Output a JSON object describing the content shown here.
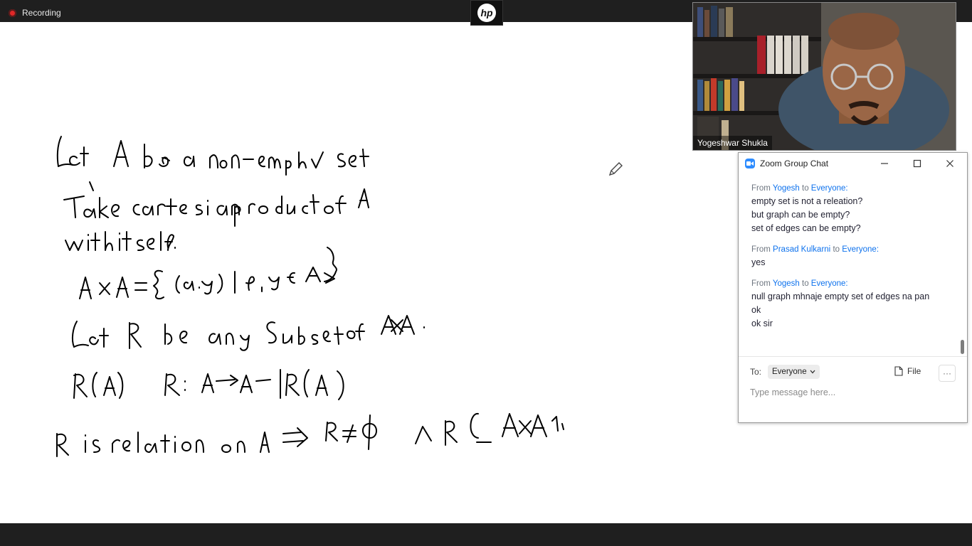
{
  "recording": {
    "label": "Recording"
  },
  "video": {
    "participant_name": "Yogeshwar Shukla"
  },
  "chat": {
    "title": "Zoom Group Chat",
    "groups": [
      {
        "from_label": "From",
        "sender": "Yogesh",
        "to_label": "to",
        "recipient": "Everyone:",
        "lines": [
          "empty set is not a releation?",
          "but graph can be empty?",
          "set of edges can be empty?"
        ]
      },
      {
        "from_label": "From",
        "sender": "Prasad Kulkarni",
        "to_label": "to",
        "recipient": "Everyone:",
        "lines": [
          "yes"
        ]
      },
      {
        "from_label": "From",
        "sender": "Yogesh",
        "to_label": "to",
        "recipient": "Everyone:",
        "lines": [
          "null graph mhnaje empty set of edges na pan",
          "ok",
          "ok sir"
        ]
      }
    ],
    "to_label": "To:",
    "to_value": "Everyone",
    "file_label": "File",
    "more_label": "···",
    "input_placeholder": "Type message here..."
  }
}
